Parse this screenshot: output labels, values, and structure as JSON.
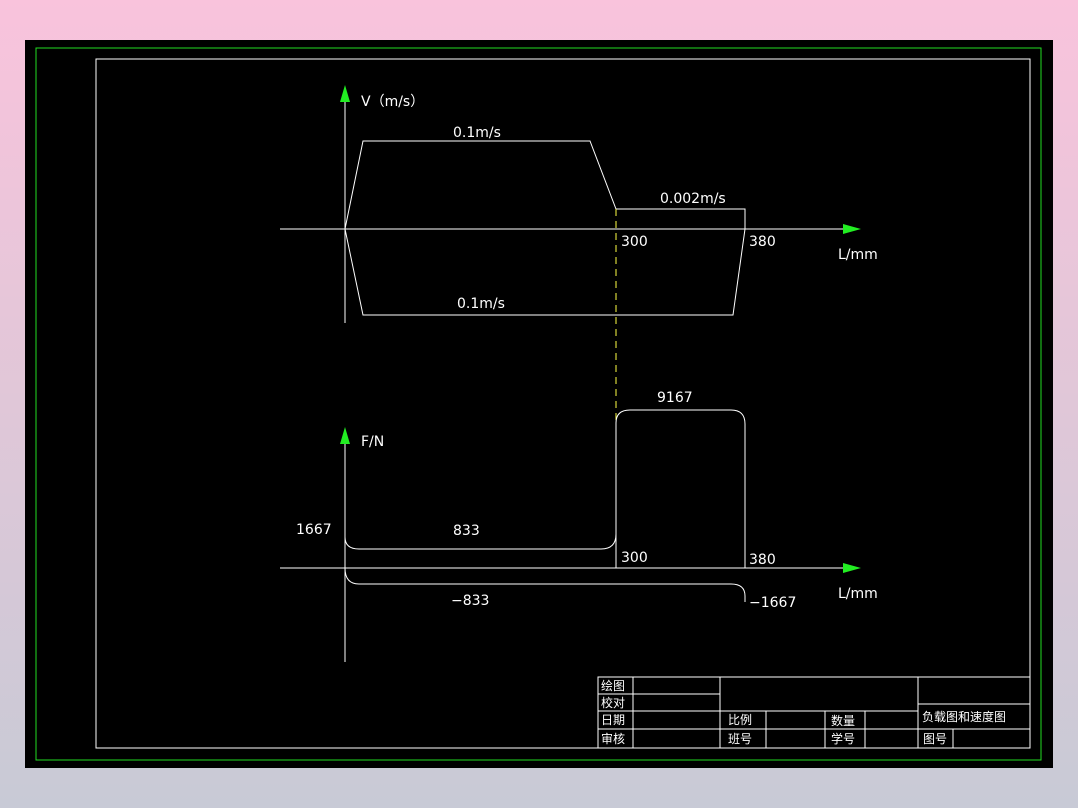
{
  "colors": {
    "background": "#000000",
    "border_outer": "#22dd22",
    "lines": "#ffffff",
    "arrow": "#22ee22",
    "dashed": "#ffff44"
  },
  "velocity_chart": {
    "axis_label_y": "V（m/s）",
    "axis_label_x": "L/mm",
    "top_speed_label": "0.1m/s",
    "slow_speed_label": "0.002m/s",
    "return_speed_label": "0.1m/s",
    "tick_300": "300",
    "tick_380": "380"
  },
  "force_chart": {
    "axis_label_y": "F/N",
    "axis_label_x": "L/mm",
    "peak_label": "9167",
    "y_value_label": "1667",
    "forward_label": "833",
    "return_label": "−833",
    "end_label": "−1667",
    "tick_300": "300",
    "tick_380": "380"
  },
  "title_block": {
    "drawn_by": "绘图",
    "checked_by": "校对",
    "date": "日期",
    "reviewed_by": "审核",
    "scale": "比例",
    "quantity": "数量",
    "class_no": "班号",
    "student_no": "学号",
    "drawing_title": "负载图和速度图",
    "drawing_no": "图号"
  }
}
